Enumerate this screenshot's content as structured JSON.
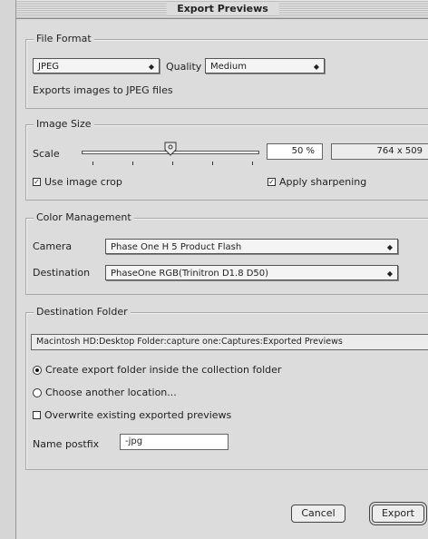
{
  "window": {
    "title": "Export Previews"
  },
  "file_format": {
    "group_title": "File Format",
    "format_value": "JPEG",
    "quality_label": "Quality",
    "quality_value": "Medium",
    "description": "Exports images to JPEG files"
  },
  "image_size": {
    "group_title": "Image Size",
    "scale_label": "Scale",
    "scale_percent": "50 %",
    "dimensions": "764 x 509",
    "slider_fraction": 0.5,
    "use_crop_label": "Use image crop",
    "use_crop_checked": true,
    "apply_sharpening_label": "Apply sharpening",
    "apply_sharpening_checked": true
  },
  "color_management": {
    "group_title": "Color Management",
    "camera_label": "Camera",
    "camera_value": "Phase One H 5  Product Flash",
    "destination_label": "Destination",
    "destination_value": "PhaseOne RGB(Trinitron D1.8 D50)"
  },
  "destination_folder": {
    "group_title": "Destination Folder",
    "path": "Macintosh HD:Desktop Folder:capture one:Captures:Exported Previews",
    "option_inside_label": "Create export folder inside the collection folder",
    "option_another_label": "Choose another location...",
    "selected_option": "inside",
    "overwrite_label": "Overwrite existing exported previews",
    "overwrite_checked": false,
    "postfix_label": "Name postfix",
    "postfix_value": "-jpg"
  },
  "buttons": {
    "cancel": "Cancel",
    "export": "Export"
  },
  "icons": {
    "check": "✓",
    "popup_arrow": "◆"
  }
}
